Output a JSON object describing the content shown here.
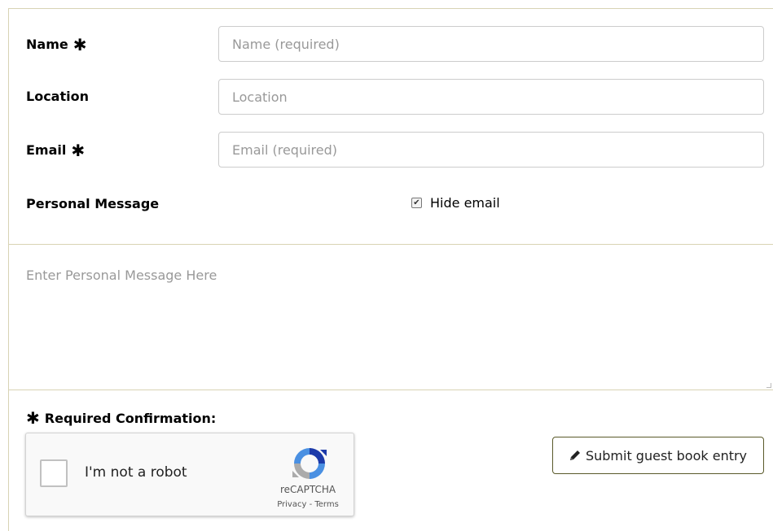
{
  "form": {
    "name_label": "Name",
    "name_placeholder": "Name (required)",
    "location_label": "Location",
    "location_placeholder": "Location",
    "email_label": "Email",
    "email_placeholder": "Email (required)",
    "message_label": "Personal Message",
    "hide_email_label": "Hide email",
    "hide_email_checked": true,
    "message_placeholder": "Enter Personal Message Here",
    "required_symbol": "✱",
    "required_confirmation_label": "Required Confirmation:"
  },
  "captcha": {
    "label": "I'm not a robot",
    "brand": "reCAPTCHA",
    "links": "Privacy - Terms",
    "icon": "recaptcha-logo-icon"
  },
  "submit": {
    "label": "Submit guest book entry",
    "icon": "pencil-icon"
  }
}
